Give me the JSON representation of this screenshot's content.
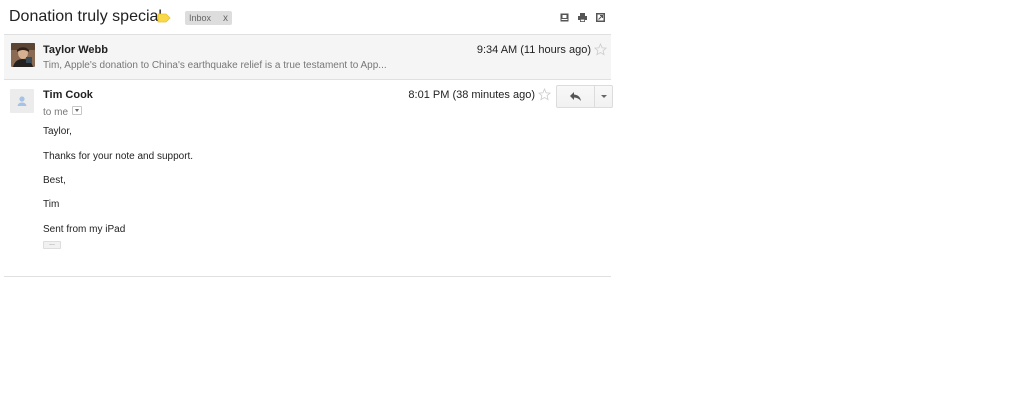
{
  "thread": {
    "subject": "Donation truly special",
    "label": "Inbox",
    "label_remove": "x",
    "label_color": "#f9d849"
  },
  "toolbar_icons": [
    "new-window-icon",
    "print-icon",
    "expand-all-icon"
  ],
  "messages": [
    {
      "sender": "Taylor Webb",
      "snippet": "Tim, Apple's donation to China's earthquake relief is a true testament to App...",
      "time": "9:34 AM (11 hours ago)",
      "avatar": "photo",
      "starred": false
    },
    {
      "sender": "Tim Cook",
      "recipient": "to me",
      "time": "8:01 PM (38 minutes ago)",
      "avatar": "default-person",
      "starred": false,
      "body": [
        "Taylor,",
        "Thanks for your note and support.",
        "Best,",
        "Tim",
        "Sent from my iPad"
      ],
      "trimmed_content": "..."
    }
  ],
  "colors": {
    "collapsed_bg": "#f5f5f5",
    "border": "#e0e0e0",
    "secondary_text": "#777777"
  }
}
